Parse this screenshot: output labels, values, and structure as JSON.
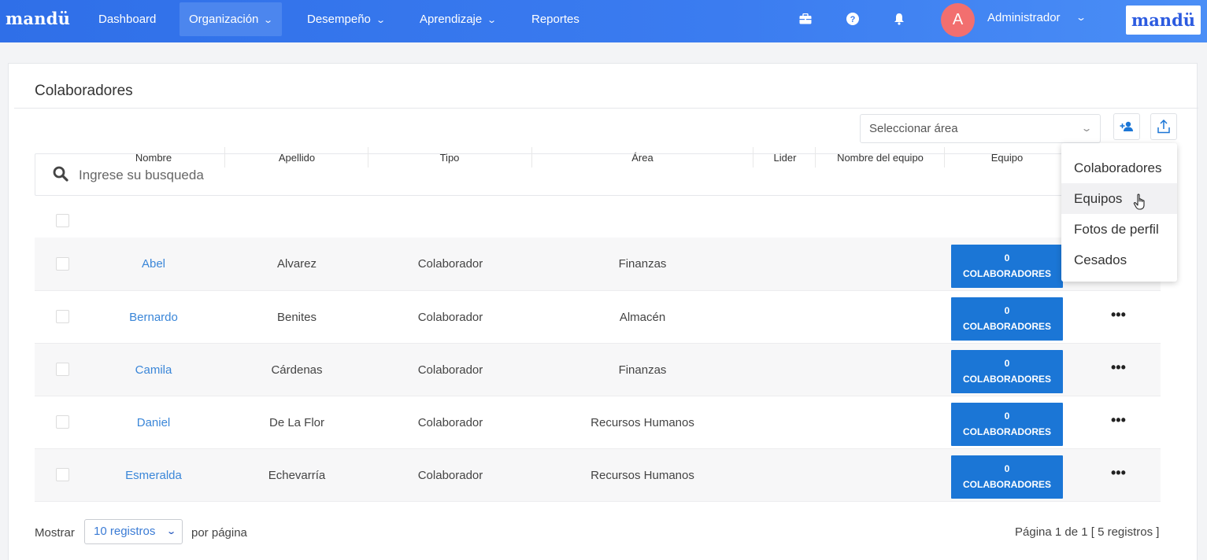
{
  "nav": {
    "brand": "mandü",
    "items": [
      {
        "label": "Dashboard",
        "has_menu": false
      },
      {
        "label": "Organización",
        "has_menu": true,
        "active": true
      },
      {
        "label": "Desempeño",
        "has_menu": true
      },
      {
        "label": "Aprendizaje",
        "has_menu": true
      },
      {
        "label": "Reportes",
        "has_menu": false
      }
    ],
    "icons": [
      "briefcase-icon",
      "help-icon",
      "bell-icon"
    ],
    "avatar_letter": "A",
    "user_name": "Administrador",
    "logo_text": "mandü",
    "accent": "#2f6fe8"
  },
  "page": {
    "title": "Colaboradores",
    "area_placeholder": "Seleccionar área",
    "search_placeholder": "Ingrese su busqueda"
  },
  "table": {
    "headers": [
      "Nombre",
      "Apellido",
      "Tipo",
      "Área",
      "Lider",
      "Nombre del equipo",
      "Equipo"
    ],
    "rows": [
      {
        "nombre": "Abel",
        "apellido": "Alvarez",
        "tipo": "Colaborador",
        "area": "Finanzas",
        "lider": "",
        "nombre_equipo": "",
        "equipo_count": "0",
        "equipo_label": "COLABORADORES"
      },
      {
        "nombre": "Bernardo",
        "apellido": "Benites",
        "tipo": "Colaborador",
        "area": "Almacén",
        "lider": "",
        "nombre_equipo": "",
        "equipo_count": "0",
        "equipo_label": "COLABORADORES"
      },
      {
        "nombre": "Camila",
        "apellido": "Cárdenas",
        "tipo": "Colaborador",
        "area": "Finanzas",
        "lider": "",
        "nombre_equipo": "",
        "equipo_count": "0",
        "equipo_label": "COLABORADORES"
      },
      {
        "nombre": "Daniel",
        "apellido": "De La Flor",
        "tipo": "Colaborador",
        "area": "Recursos Humanos",
        "lider": "",
        "nombre_equipo": "",
        "equipo_count": "0",
        "equipo_label": "COLABORADORES"
      },
      {
        "nombre": "Esmeralda",
        "apellido": "Echevarría",
        "tipo": "Colaborador",
        "area": "Recursos Humanos",
        "lider": "",
        "nombre_equipo": "",
        "equipo_count": "0",
        "equipo_label": "COLABORADORES"
      }
    ],
    "actions_glyph": "•••"
  },
  "export_menu": {
    "items": [
      "Colaboradores",
      "Equipos",
      "Fotos de perfil",
      "Cesados"
    ],
    "hovered": "Equipos"
  },
  "footer": {
    "show_label": "Mostrar",
    "per_page_value": "10 registros",
    "per_page_suffix": "por página",
    "pagination": "Página 1 de 1 [ 5 registros ]"
  }
}
